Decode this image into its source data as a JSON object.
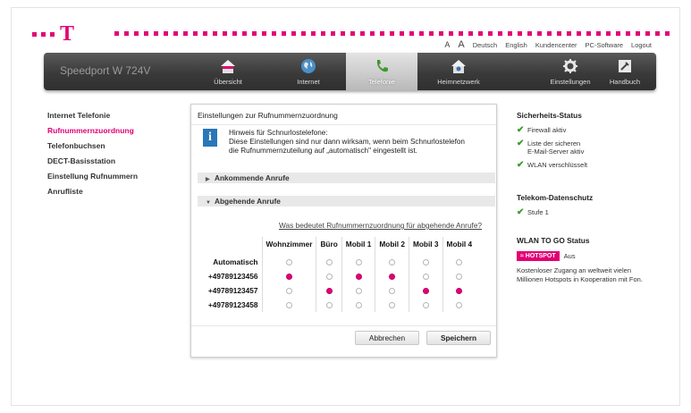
{
  "header": {
    "font_small": "A",
    "font_large": "A",
    "links": [
      "Deutsch",
      "English",
      "Kundencenter",
      "PC-Software",
      "Logout"
    ]
  },
  "navbar": {
    "brand": "Speedport W 724V",
    "items": [
      {
        "label": "Übersicht",
        "icon": "house-icon"
      },
      {
        "label": "Internet",
        "icon": "globe-icon"
      },
      {
        "label": "Telefonie",
        "icon": "phone-icon",
        "active": true
      },
      {
        "label": "Heimnetzwerk",
        "icon": "home-network-icon"
      },
      {
        "label": "Einstellungen",
        "icon": "gear-icon"
      },
      {
        "label": "Handbuch",
        "icon": "manual-icon"
      }
    ]
  },
  "sidebar": {
    "items": [
      {
        "label": "Internet Telefonie"
      },
      {
        "label": "Rufnummernzuordnung",
        "active": true
      },
      {
        "label": "Telefonbuchsen"
      },
      {
        "label": "DECT-Basisstation"
      },
      {
        "label": "Einstellung Rufnummern"
      },
      {
        "label": "Anrufliste"
      }
    ]
  },
  "panel": {
    "title": "Einstellungen zur Rufnummernzuordnung",
    "hint_line1": "Hinweis für Schnurlostelefone:",
    "hint_line2": "Diese Einstellungen sind nur dann wirksam, wenn beim Schnurlostelefon",
    "hint_line3": "die Rufnummernzuteilung auf „automatisch\" eingestellt ist.",
    "section_incoming": "Ankommende Anrufe",
    "section_outgoing": "Abgehende Anrufe",
    "help_link": "Was bedeutet Rufnummernzuordnung für abgehende Anrufe?",
    "columns": [
      "Wohnzimmer",
      "Büro",
      "Mobil 1",
      "Mobil 2",
      "Mobil 3",
      "Mobil 4"
    ],
    "rows": [
      {
        "label": "Automatisch",
        "selected": []
      },
      {
        "label": "+49789123456",
        "selected": [
          0,
          2,
          3
        ]
      },
      {
        "label": "+49789123457",
        "selected": [
          1,
          4,
          5
        ]
      },
      {
        "label": "+49789123458",
        "selected": []
      }
    ],
    "cancel_label": "Abbrechen",
    "save_label": "Speichern"
  },
  "right": {
    "security_title": "Sicherheits-Status",
    "security_items": [
      "Firewall aktiv",
      "Liste der sicheren",
      "E-Mail-Server aktiv",
      "WLAN verschlüsselt"
    ],
    "privacy_title": "Telekom-Datenschutz",
    "privacy_level": "Stufe 1",
    "wlan_title": "WLAN TO GO Status",
    "hotspot_badge": "HOTSPOT",
    "hotspot_status": "Aus",
    "wlan_desc_line1": "Kostenloser Zugang an weltweit vielen",
    "wlan_desc_line2": "Millionen Hotspots in Kooperation mit Fon."
  },
  "colors": {
    "brand": "#e20074",
    "check": "#3a9b2a",
    "info": "#2a77b8"
  }
}
